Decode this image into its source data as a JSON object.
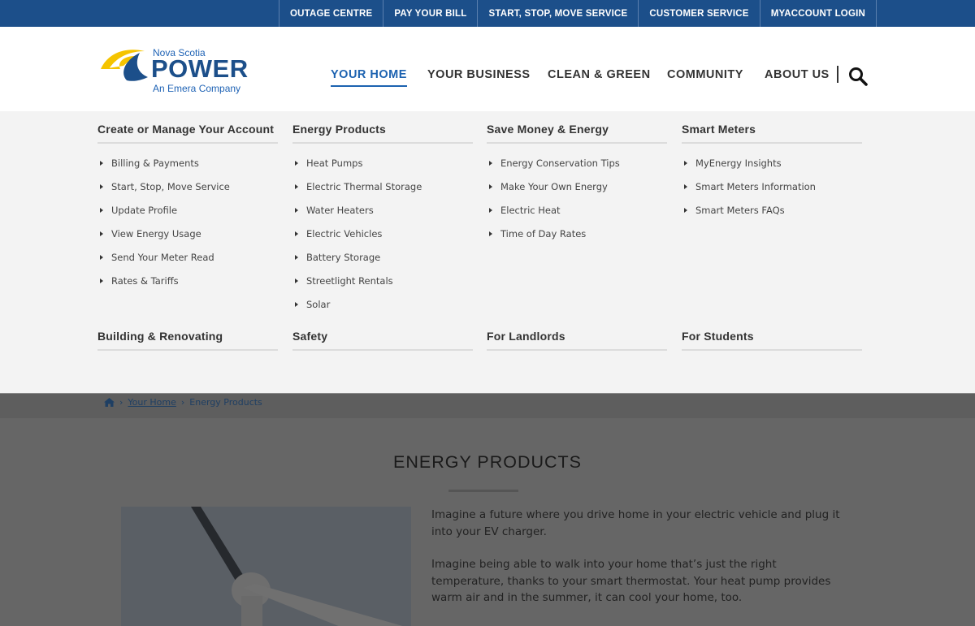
{
  "topbar": {
    "links": [
      {
        "label": "OUTAGE CENTRE"
      },
      {
        "label": "PAY YOUR BILL"
      },
      {
        "label": "START, STOP, MOVE SERVICE"
      },
      {
        "label": "CUSTOMER SERVICE"
      },
      {
        "label": "MYACCOUNT LOGIN"
      }
    ],
    "bg_color": "#1c4f8a"
  },
  "logo": {
    "small_text": "Nova Scotia",
    "brand": "POWER",
    "subtitle": "An Emera Company",
    "colors": {
      "yellow": "#f5c400",
      "blue": "#1c4f8a",
      "light_blue": "#1f63b5"
    }
  },
  "nav": {
    "items": [
      {
        "label": "YOUR HOME",
        "active": true
      },
      {
        "label": "YOUR BUSINESS"
      },
      {
        "label": "CLEAN & GREEN"
      },
      {
        "label": "COMMUNITY"
      },
      {
        "label": "ABOUT US"
      }
    ],
    "search_icon": "search-icon",
    "accent_color": "#1c62b0"
  },
  "mega_menu": {
    "columns": [
      {
        "heading": "Create or Manage Your Account",
        "links": [
          "Billing & Payments",
          "Start, Stop, Move Service",
          "Update Profile",
          "View Energy Usage",
          "Send Your Meter Read",
          "Rates & Tariffs"
        ]
      },
      {
        "heading": "Energy Products",
        "links": [
          "Heat Pumps",
          "Electric Thermal Storage",
          "Water Heaters",
          "Electric Vehicles",
          "Battery Storage",
          "Streetlight Rentals",
          "Solar"
        ]
      },
      {
        "heading": "Save Money & Energy",
        "links": [
          "Energy Conservation Tips",
          "Make Your Own Energy",
          "Electric Heat",
          "Time of Day Rates"
        ]
      },
      {
        "heading": "Smart Meters",
        "links": [
          "MyEnergy Insights",
          "Smart Meters Information",
          "Smart Meters FAQs"
        ]
      },
      {
        "heading": "Building & Renovating",
        "links": []
      },
      {
        "heading": "Safety",
        "links": []
      },
      {
        "heading": "For Landlords",
        "links": []
      },
      {
        "heading": "For Students",
        "links": []
      }
    ]
  },
  "breadcrumb": {
    "home_icon": "home-icon",
    "items": [
      "Your Home",
      "Energy Products"
    ]
  },
  "page": {
    "title": "ENERGY PRODUCTS",
    "paragraphs": [
      "Imagine a future where you drive home in your electric vehicle and plug it into your EV charger.",
      "Imagine being able to walk into your home that’s just the right temperature, thanks to your smart thermostat. Your heat pump provides warm air and in the summer, it can cool your home, too."
    ]
  }
}
